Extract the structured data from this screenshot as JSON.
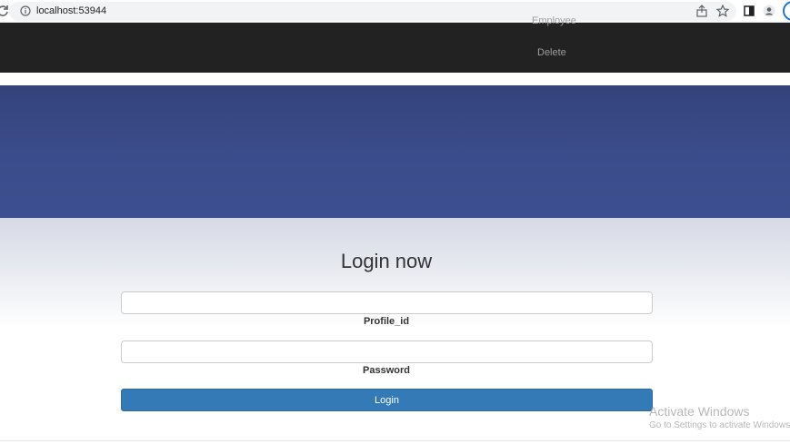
{
  "browser": {
    "url": "localhost:53944"
  },
  "navbar": {
    "clipped_item": "Employee",
    "delete_label": "Delete"
  },
  "login": {
    "title": "Login now",
    "profile_label": "Profile_id",
    "password_label": "Password",
    "button_label": "Login",
    "profile_value": "",
    "password_value": ""
  },
  "watermark": {
    "title": "Activate Windows",
    "subtitle": "Go to Settings to activate Windows."
  },
  "colors": {
    "navbar": "#222222",
    "hero": "#3b4c8b",
    "button": "#337ab7"
  }
}
